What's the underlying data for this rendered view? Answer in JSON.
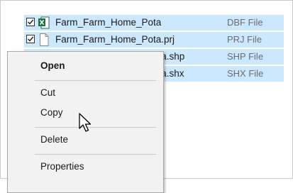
{
  "files": [
    {
      "name": "Farm_Farm_Home_Pota",
      "type": "DBF File",
      "icon": "excel-file-icon",
      "checked": true
    },
    {
      "name": "Farm_Farm_Home_Pota.prj",
      "type": "PRJ File",
      "icon": "generic-file-icon",
      "checked": true
    },
    {
      "name": "ota.shp",
      "type": "SHP File",
      "icon": "generic-file-icon",
      "checked": true
    },
    {
      "name": "ota.shx",
      "type": "SHX File",
      "icon": "generic-file-icon",
      "checked": true
    }
  ],
  "context_menu": {
    "open": "Open",
    "cut": "Cut",
    "copy": "Copy",
    "delete": "Delete",
    "properties": "Properties"
  },
  "colors": {
    "selection": "#cce8ff",
    "menu_background": "#f2f2f2",
    "excel_green": "#1e7145"
  }
}
